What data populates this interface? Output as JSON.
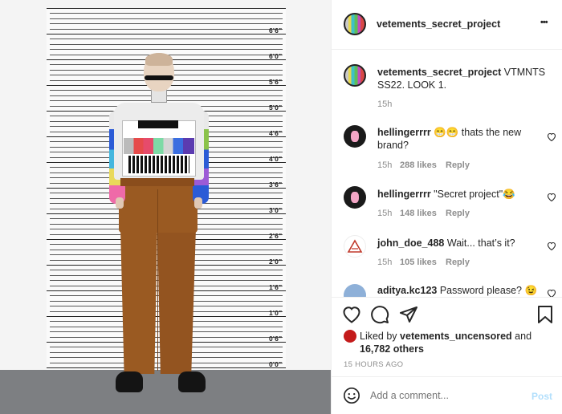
{
  "photo": {
    "height_labels": [
      "6'6\"",
      "6'0\"",
      "5'6\"",
      "5'0\"",
      "4'6\"",
      "4'0\"",
      "3'6\"",
      "3'0\"",
      "2'6\"",
      "2'0\"",
      "1'6\"",
      "1'0\"",
      "0'6\"",
      "0'0\""
    ]
  },
  "header": {
    "username": "vetements_secret_project",
    "more_label": "•••"
  },
  "caption": {
    "username": "vetements_secret_project",
    "text": "VTMNTS SS22. LOOK 1.",
    "time": "15h"
  },
  "comments": [
    {
      "username": "hellingerrrr",
      "text": "😁😁 thats the new brand?",
      "time": "15h",
      "likes": "288 likes",
      "reply": "Reply"
    },
    {
      "username": "hellingerrrr",
      "text": "\"Secret project\"😂",
      "time": "15h",
      "likes": "148 likes",
      "reply": "Reply"
    },
    {
      "username": "john_doe_488",
      "text": "Wait... that’s it?",
      "time": "15h",
      "likes": "105 likes",
      "reply": "Reply"
    },
    {
      "username": "aditya.kc123",
      "text": "Password please? 😉",
      "time": "",
      "likes": "",
      "reply": ""
    }
  ],
  "likes": {
    "prefix": "Liked by",
    "username": "vetements_uncensored",
    "and": "and",
    "others": "16,782 others"
  },
  "timestamp": "15 HOURS AGO",
  "add_comment": {
    "placeholder": "Add a comment...",
    "post_label": "Post"
  },
  "colors": {
    "link_blue": "#0095f6",
    "post_disabled": "#b2dffc",
    "muted": "#8e8e8e"
  }
}
